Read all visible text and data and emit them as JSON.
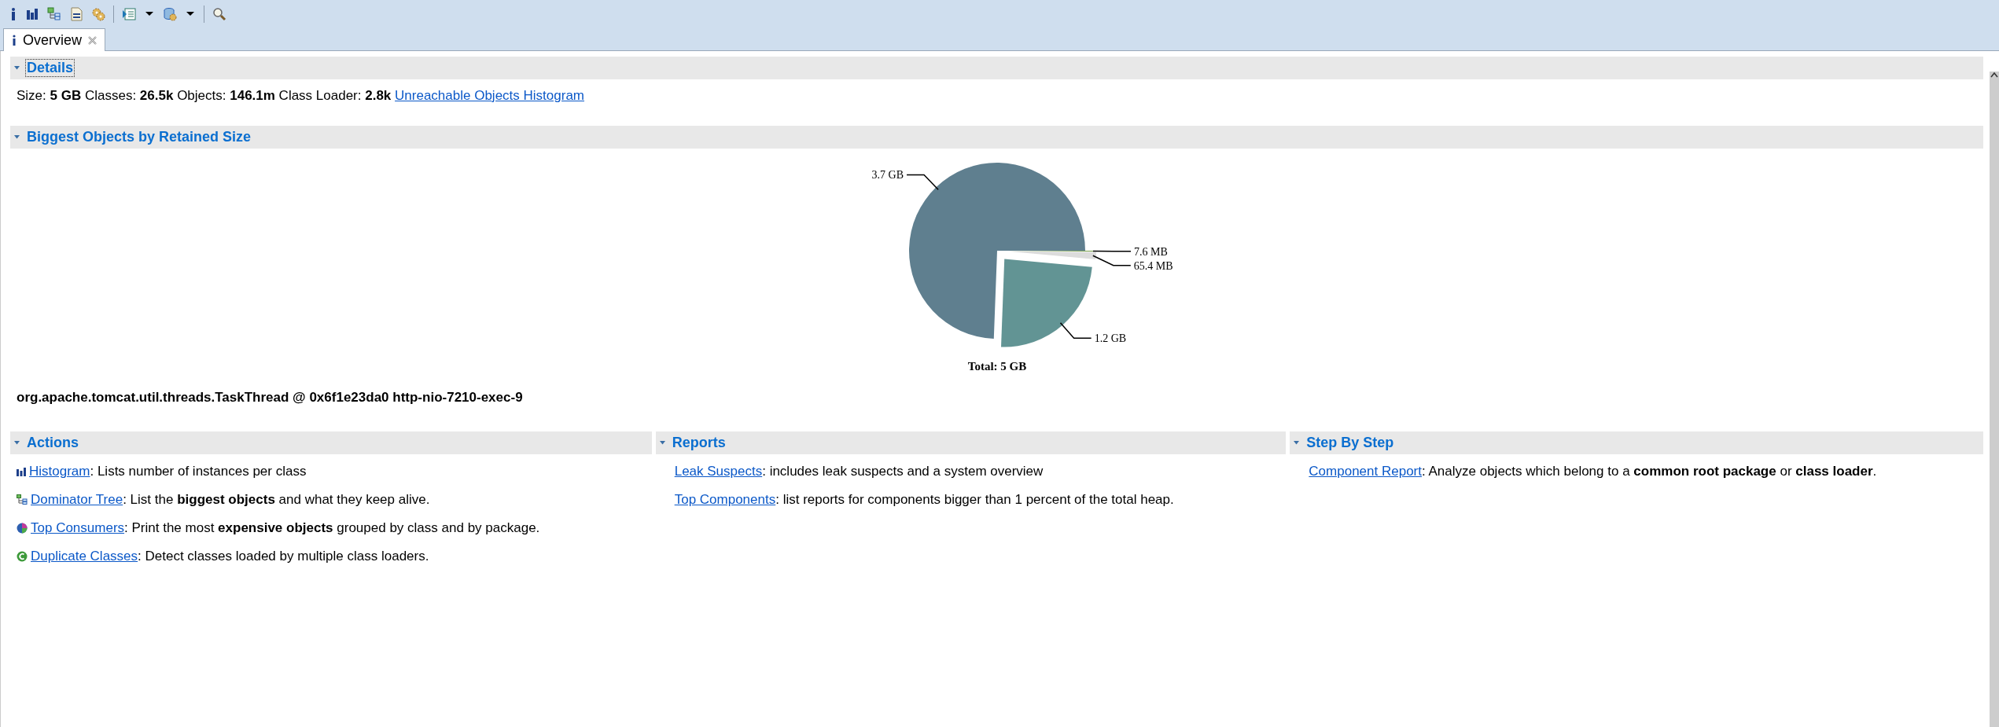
{
  "tabs": [
    {
      "label": "Overview",
      "selected": true
    }
  ],
  "details": {
    "title": "Details",
    "expanded": true,
    "focused": true,
    "text": "Size: **5 GB** Classes: **26.5k** Objects: **146.1m** Class Loader: **2.8k**",
    "link": "Unreachable Objects Histogram"
  },
  "biggest_objects": {
    "title": "Biggest Objects by Retained Size",
    "expanded": true,
    "focused": false,
    "chart_data": {
      "type": "pie",
      "title": "Total: 5 GB",
      "values": [
        74.4,
        24.13,
        1.32,
        0.15
      ],
      "colors": [
        "#5f7f8f",
        "#629494",
        "#dcdcdc",
        "#6f9a3c"
      ]
    },
    "slice_labels": [
      "3.7 GB",
      "1.2 GB",
      "65.4 MB",
      "7.6 MB"
    ],
    "object_line": "org.apache.tomcat.util.threads.TaskThread @ 0x6f1e23da0 http-nio-7210-exec-9"
  },
  "columns": [
    {
      "title": "Actions",
      "expanded": true,
      "focused": false,
      "items": [
        {
          "kind": "histogram",
          "link": "Histogram",
          "text": ": Lists number of instances per class"
        },
        {
          "kind": "dominator_tree",
          "link": "Dominator Tree",
          "text": ": List the **biggest objects** and what they keep alive."
        },
        {
          "kind": "top_consumers",
          "link": "Top Consumers",
          "text": ": Print the most **expensive objects** grouped by class and by package."
        },
        {
          "kind": "duplicate_classes",
          "link": "Duplicate Classes",
          "text": ": Detect classes loaded by multiple class loaders."
        }
      ]
    },
    {
      "title": "Reports",
      "expanded": true,
      "focused": false,
      "items": [
        {
          "kind": "report",
          "link": "Leak Suspects",
          "text": ": includes leak suspects and a system overview"
        },
        {
          "kind": "report",
          "link": "Top Components",
          "text": ": list reports for components bigger than 1 percent of the total heap."
        }
      ]
    },
    {
      "title": "Step By Step",
      "expanded": true,
      "focused": false,
      "items": [
        {
          "kind": "report",
          "link": "Component Report",
          "text": ": Analyze objects which belong to a **common root package** or **class loader**."
        }
      ]
    }
  ]
}
